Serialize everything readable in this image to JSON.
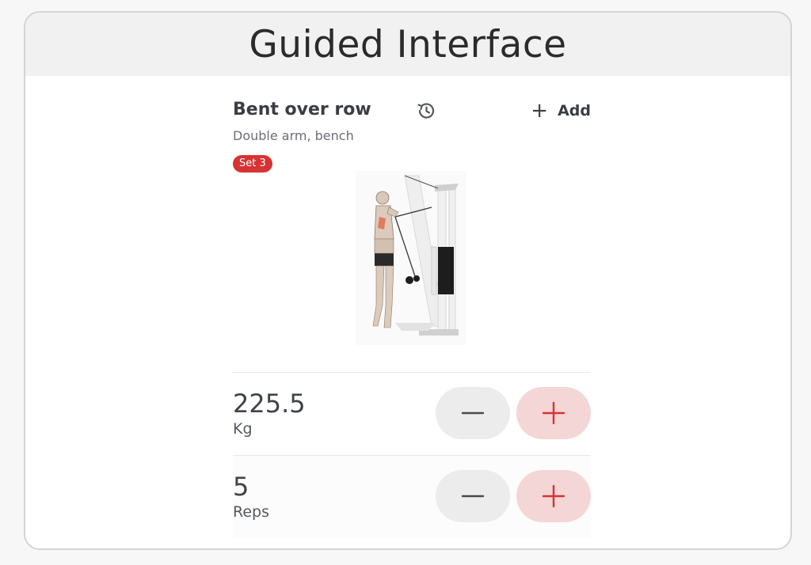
{
  "header": {
    "title": "Guided Interface"
  },
  "exercise": {
    "name": "Bent over row",
    "subtitle": "Double arm, bench",
    "set_badge": "Set 3",
    "add_label": "Add",
    "history_icon": "history-icon",
    "add_icon": "plus-icon"
  },
  "weight": {
    "value": "225.5",
    "unit": "Kg"
  },
  "reps": {
    "value": "5",
    "unit": "Reps"
  },
  "colors": {
    "accent": "#d63333",
    "plus_button_bg": "#f4d6d6",
    "minus_button_bg": "#ececec"
  }
}
